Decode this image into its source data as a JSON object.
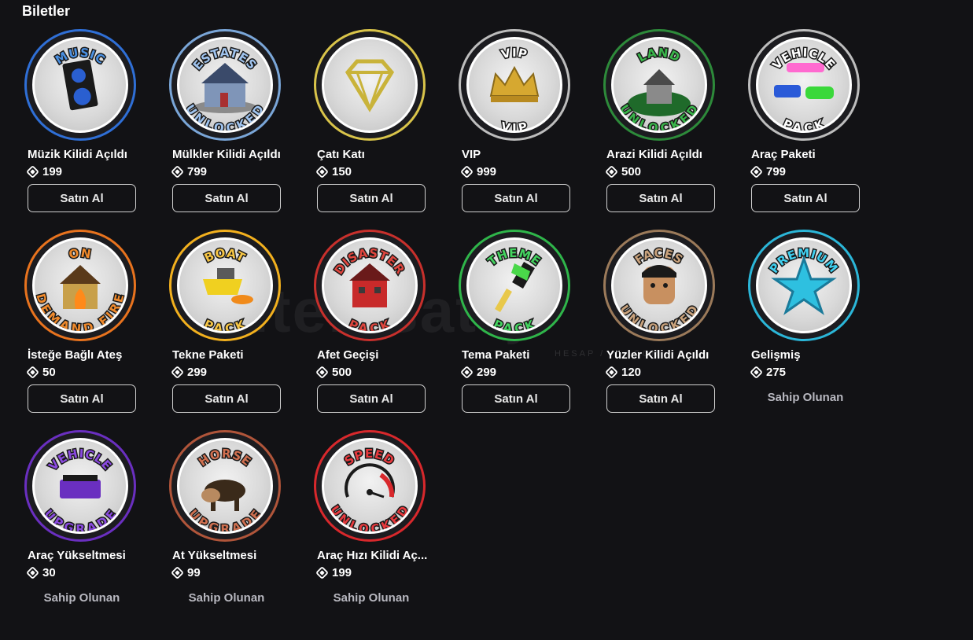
{
  "section_title": "Biletler",
  "watermark": {
    "brand": "itemsatış",
    "tagline": "HESAP / ... .COM"
  },
  "items": [
    {
      "name": "Müzik Kilidi Açıldı",
      "price": "199",
      "action": "Satın Al",
      "badge_top": "MUSIC",
      "badge_bottom": "",
      "ring_color": "#2f6fd6",
      "text_color": "#4a90e2",
      "icon": "speaker-icon"
    },
    {
      "name": "Mülkler Kilidi Açıldı",
      "price": "799",
      "action": "Satın Al",
      "badge_top": "ESTATES",
      "badge_bottom": "UNLOCKED",
      "ring_color": "#7aa6d8",
      "text_color": "#9fc3ee",
      "icon": "house-icon"
    },
    {
      "name": "Çatı Katı",
      "price": "150",
      "action": "Satın Al",
      "badge_top": "",
      "badge_bottom": "",
      "ring_color": "#d9c44a",
      "text_color": "#e8d36a",
      "icon": "diamond-icon"
    },
    {
      "name": "VIP",
      "price": "999",
      "action": "Satın Al",
      "badge_top": "VIP",
      "badge_bottom": "VIP",
      "ring_color": "#bdbdbd",
      "text_color": "#ffffff",
      "icon": "crown-icon"
    },
    {
      "name": "Arazi Kilidi Açıldı",
      "price": "500",
      "action": "Satın Al",
      "badge_top": "LAND",
      "badge_bottom": "UNLOCKED",
      "ring_color": "#2d8a3a",
      "text_color": "#39b54a",
      "icon": "land-icon"
    },
    {
      "name": "Araç Paketi",
      "price": "799",
      "action": "Satın Al",
      "badge_top": "VEHICLE",
      "badge_bottom": "PACK",
      "ring_color": "#bdbdbd",
      "text_color": "#ffffff",
      "icon": "cars-icon"
    },
    {
      "name": "İsteğe Bağlı Ateş",
      "price": "50",
      "action": "Satın Al",
      "badge_top": "ON",
      "badge_bottom": "DEMAND FIRE",
      "ring_color": "#e8731e",
      "text_color": "#f08a2c",
      "icon": "burning-house-icon"
    },
    {
      "name": "Tekne Paketi",
      "price": "299",
      "action": "Satın Al",
      "badge_top": "BOAT",
      "badge_bottom": "PACK",
      "ring_color": "#f2b01e",
      "text_color": "#f6c544",
      "icon": "boat-icon"
    },
    {
      "name": "Afet Geçişi",
      "price": "500",
      "action": "Satın Al",
      "badge_top": "DISASTER",
      "badge_bottom": "PACK",
      "ring_color": "#c8302c",
      "text_color": "#e0463e",
      "icon": "disaster-house-icon"
    },
    {
      "name": "Tema Paketi",
      "price": "299",
      "action": "Satın Al",
      "badge_top": "THEME",
      "badge_bottom": "PACK",
      "ring_color": "#2fb54a",
      "text_color": "#43d35f",
      "icon": "paintbrush-icon"
    },
    {
      "name": "Yüzler Kilidi Açıldı",
      "price": "120",
      "action": "Satın Al",
      "badge_top": "FACES",
      "badge_bottom": "UNLOCKED",
      "ring_color": "#9b7a5a",
      "text_color": "#c9a27c",
      "icon": "face-icon"
    },
    {
      "name": "Gelişmiş",
      "price": "275",
      "action": "Sahip Olunan",
      "badge_top": "PREMIUM",
      "badge_bottom": "",
      "ring_color": "#2bb6d8",
      "text_color": "#3fd0f0",
      "icon": "star-icon"
    },
    {
      "name": "Araç Yükseltmesi",
      "price": "30",
      "action": "Sahip Olunan",
      "badge_top": "VEHICLE",
      "badge_bottom": "UPGRADE",
      "ring_color": "#6a2fc0",
      "text_color": "#8a4ae0",
      "icon": "vehicle-upgrade-icon"
    },
    {
      "name": "At Yükseltmesi",
      "price": "99",
      "action": "Sahip Olunan",
      "badge_top": "HORSE",
      "badge_bottom": "UPGRADE",
      "ring_color": "#b0553a",
      "text_color": "#d07050",
      "icon": "horse-icon"
    },
    {
      "name": "Araç Hızı Kilidi Aç...",
      "price": "199",
      "action": "Sahip Olunan",
      "badge_top": "SPEED",
      "badge_bottom": "UNLOCKED",
      "ring_color": "#d8282c",
      "text_color": "#e83a3e",
      "icon": "speedometer-icon"
    }
  ]
}
